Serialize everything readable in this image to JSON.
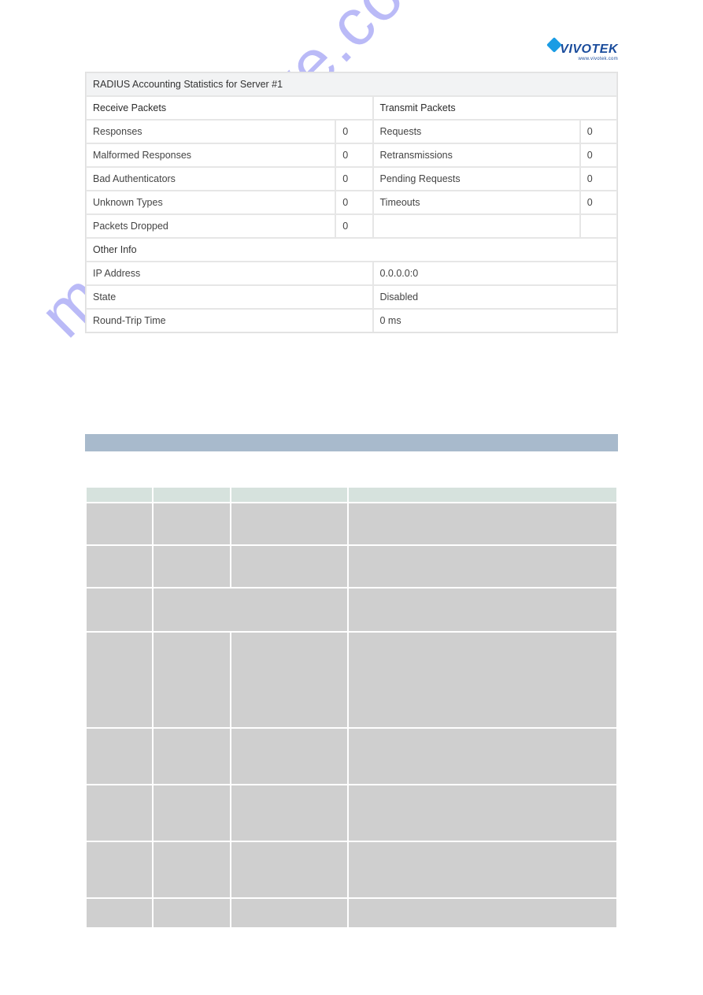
{
  "logo": {
    "text": "VIVOTEK",
    "sub": "www.vivotek.com"
  },
  "watermark": "manualshive.com",
  "table_title": "RADIUS Accounting Statistics for Server #1",
  "receive_header": "Receive Packets",
  "transmit_header": "Transmit Packets",
  "rows": [
    {
      "rx_label": "Responses",
      "rx_val": "0",
      "tx_label": "Requests",
      "tx_val": "0"
    },
    {
      "rx_label": "Malformed Responses",
      "rx_val": "0",
      "tx_label": "Retransmissions",
      "tx_val": "0"
    },
    {
      "rx_label": "Bad Authenticators",
      "rx_val": "0",
      "tx_label": "Pending Requests",
      "tx_val": "0"
    },
    {
      "rx_label": "Unknown Types",
      "rx_val": "0",
      "tx_label": "Timeouts",
      "tx_val": "0"
    },
    {
      "rx_label": "Packets Dropped",
      "rx_val": "0",
      "tx_label": "",
      "tx_val": ""
    }
  ],
  "other_info_header": "Other Info",
  "other": [
    {
      "label": "IP Address",
      "value": "0.0.0.0:0"
    },
    {
      "label": "State",
      "value": "Disabled"
    },
    {
      "label": "Round-Trip Time",
      "value": "0 ms"
    }
  ]
}
